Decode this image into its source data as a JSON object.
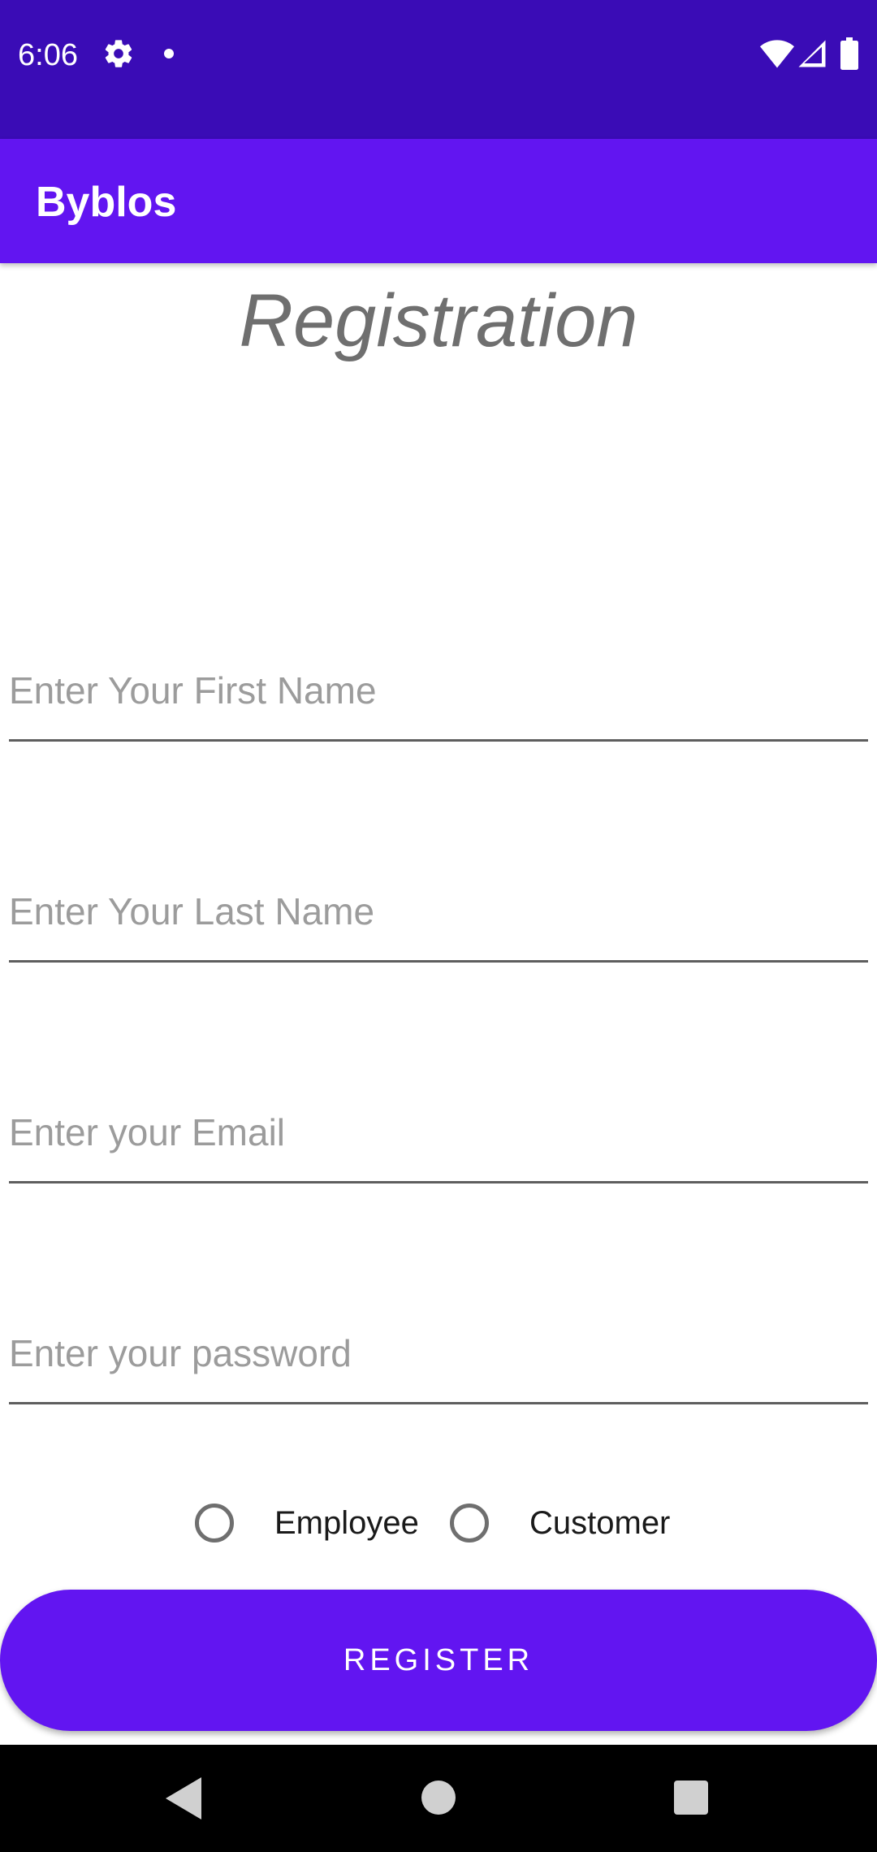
{
  "status_bar": {
    "time": "6:06",
    "icons": [
      "gear-icon",
      "notification-dot-icon",
      "wifi-icon",
      "signal-icon",
      "battery-icon"
    ]
  },
  "app_bar": {
    "title": "Byblos"
  },
  "page": {
    "title": "Registration"
  },
  "form": {
    "first_name": {
      "placeholder": "Enter Your First Name",
      "value": ""
    },
    "last_name": {
      "placeholder": "Enter Your Last Name",
      "value": ""
    },
    "email": {
      "placeholder": "Enter your Email",
      "value": ""
    },
    "password": {
      "placeholder": "Enter your password",
      "value": ""
    },
    "role_options": [
      {
        "label": "Employee",
        "selected": false
      },
      {
        "label": "Customer",
        "selected": false
      }
    ],
    "register_label": "REGISTER"
  },
  "nav_bar": {
    "icons": [
      "back-icon",
      "home-icon",
      "recents-icon"
    ]
  },
  "colors": {
    "status_bar": "#3a0cb6",
    "primary": "#6215f1",
    "title_text": "#6f6f6f",
    "hint_text": "#9c9c9c"
  }
}
